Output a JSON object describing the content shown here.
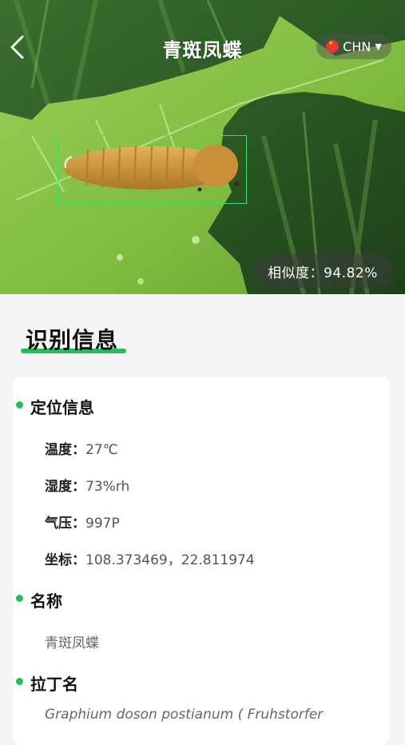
{
  "header": {
    "title": "青斑凤蝶",
    "language": "CHN"
  },
  "detection": {
    "similarity_label": "相似度：94.82%"
  },
  "section": {
    "title": "识别信息"
  },
  "location": {
    "heading": "定位信息",
    "temperature_label": "温度：",
    "temperature_value": "27℃",
    "humidity_label": "湿度：",
    "humidity_value": "73%rh",
    "pressure_label": "气压：",
    "pressure_value": "997P",
    "coord_label": "坐标：",
    "coord_value": "108.373469，22.811974"
  },
  "name": {
    "heading": "名称",
    "value": "青斑凤蝶"
  },
  "latin_name": {
    "heading": "拉丁名",
    "value": "Graphium doson postianum ( Fruhstorfer"
  },
  "colors": {
    "accent": "#1fbf5a",
    "detect_box": "#39e16b"
  }
}
